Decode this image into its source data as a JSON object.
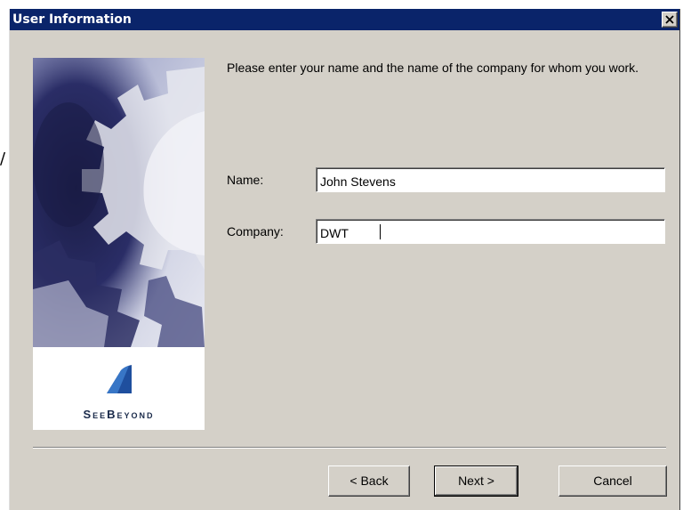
{
  "window": {
    "title": "User Information"
  },
  "stray_mark": "/",
  "side_panel": {
    "logo_text": "SeeBeyond"
  },
  "instructions": "Please enter your name and the name of the company for whom you work.",
  "form": {
    "name_label": "Name:",
    "name_value": "John Stevens",
    "company_label": "Company:",
    "company_value": "DWT"
  },
  "buttons": {
    "back": "< Back",
    "next": "Next >",
    "cancel": "Cancel"
  },
  "colors": {
    "titlebar": "#0a246a",
    "dialog_face": "#d4d0c8",
    "logo_blue": "#1f4f9e"
  }
}
